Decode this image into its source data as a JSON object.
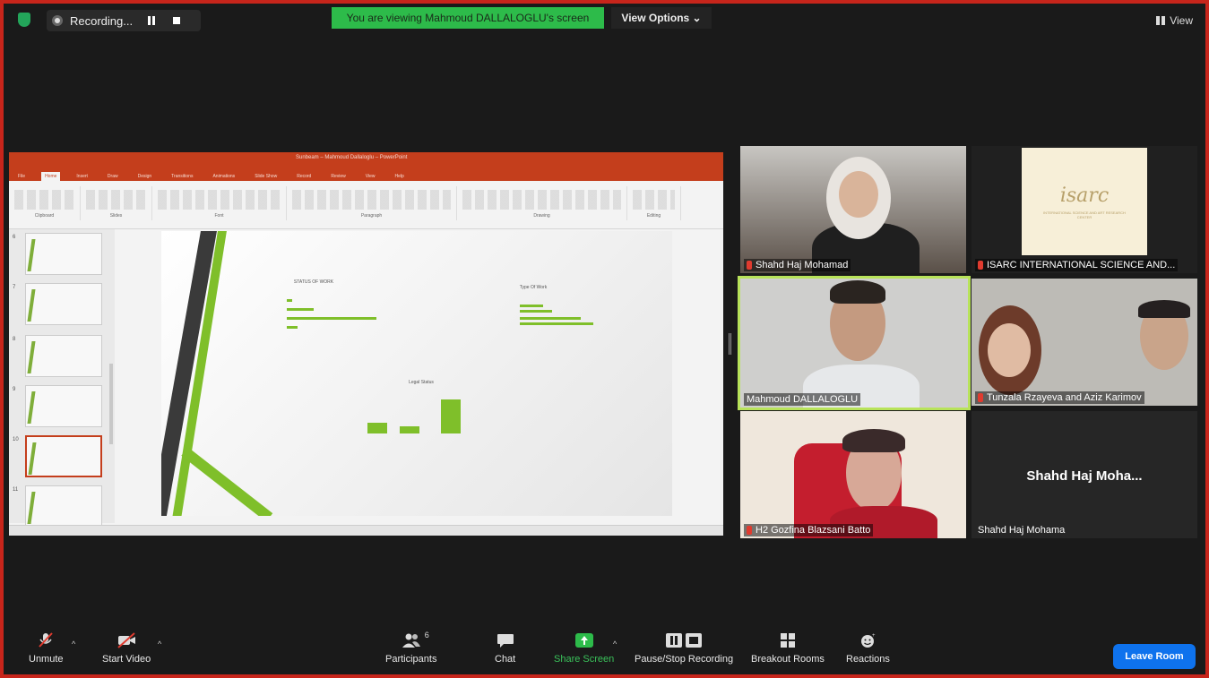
{
  "topbar": {
    "recording_label": "Recording...",
    "viewing_banner": "You are viewing Mahmoud DALLALOGLU's screen",
    "view_options_label": "View Options ⌄",
    "view_label": "View"
  },
  "share": {
    "app_title": "Sunbeam – Mahmoud Dallaloglu – PowerPoint",
    "ribbon_tabs": [
      "File",
      "Home",
      "Insert",
      "Draw",
      "Design",
      "Transitions",
      "Animations",
      "Slide Show",
      "Record",
      "Review",
      "View",
      "Help"
    ],
    "ribbon_groups": [
      "Clipboard",
      "Slides",
      "Font",
      "Paragraph",
      "Drawing",
      "Editing"
    ],
    "slide_numbers": [
      "6",
      "7",
      "8",
      "9",
      "10",
      "11"
    ],
    "slide": {
      "chart1_title": "STATUS OF WORK",
      "chart2_title": "Type Of Work",
      "chart3_title": "Legal Status"
    }
  },
  "tiles": [
    {
      "name": "Shahd Haj Mohamad"
    },
    {
      "name": "ISARC INTERNATIONAL SCIENCE AND..."
    },
    {
      "name": "Mahmoud DALLALOGLU"
    },
    {
      "name": "Tunzala Rzayeva and Aziz Karimov"
    },
    {
      "name": "H2 Gozfina Blazsani Batto"
    },
    {
      "name": "Shahd Haj Mohama",
      "big_name": "Shahd Haj Moha..."
    }
  ],
  "isarc": {
    "logo": "isarc",
    "subtitle": "INTERNATIONAL SCIENCE AND ART RESEARCH CENTER"
  },
  "toolbar": {
    "unmute": "Unmute",
    "start_video": "Start Video",
    "participants": "Participants",
    "participants_count": "6",
    "chat": "Chat",
    "share_screen": "Share Screen",
    "pause_stop_recording": "Pause/Stop Recording",
    "breakout_rooms": "Breakout Rooms",
    "reactions": "Reactions",
    "leave_room": "Leave Room"
  },
  "colors": {
    "frame_border": "#c7251b",
    "banner_green": "#2dbb4a",
    "leave_blue": "#0e72ed",
    "active_speaker": "#b8e35a"
  }
}
